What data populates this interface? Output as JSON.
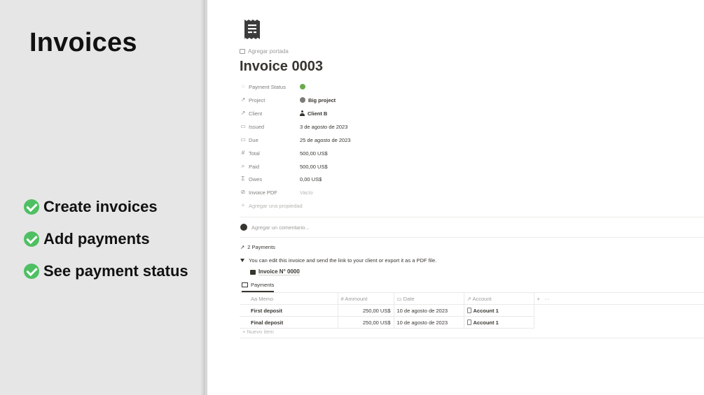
{
  "promo": {
    "title": "Invoices",
    "features": [
      "Create invoices",
      "Add payments",
      "See payment status"
    ]
  },
  "page": {
    "icon": "receipt-icon",
    "add_cover": "Agregar portada",
    "title": "Invoice 0003"
  },
  "properties": [
    {
      "name": "Payment Status",
      "icon": "status-icon",
      "value": ""
    },
    {
      "name": "Project",
      "icon": "relation-arrow-icon",
      "value": "Big project"
    },
    {
      "name": "Client",
      "icon": "relation-arrow-icon",
      "value": "Client B"
    },
    {
      "name": "Issued",
      "icon": "calendar-icon",
      "value": "3 de agosto de 2023"
    },
    {
      "name": "Due",
      "icon": "calendar-icon",
      "value": "25 de agosto de 2023"
    },
    {
      "name": "Total",
      "icon": "number-icon",
      "value": "500,00 US$"
    },
    {
      "name": "Paid",
      "icon": "rollup-search-icon",
      "value": "500,00 US$"
    },
    {
      "name": "Owes",
      "icon": "formula-icon",
      "value": "0,00 US$"
    },
    {
      "name": "Invoice PDF",
      "icon": "paperclip-icon",
      "value": "Vacío"
    }
  ],
  "add_property": "Agregar una propiedad",
  "comment_placeholder": "Agregar un comentario...",
  "payments_count": "2 Payments",
  "toggle_text": "You can edit this invoice and send the link to your client or export it as a PDF file.",
  "linked_page": "Invoice N° 0000",
  "view_tab": "Payments",
  "table": {
    "headers": [
      "Aa Memo",
      "Ammount",
      "Date",
      "Account"
    ],
    "rows": [
      {
        "memo": "First deposit",
        "amount": "250,00 US$",
        "date": "10 de agosto de 2023",
        "account": "Account 1"
      },
      {
        "memo": "Final deposit",
        "amount": "250,00 US$",
        "date": "10 de agosto de 2023",
        "account": "Account 1"
      }
    ],
    "add_col": "+",
    "more": "···",
    "new_item": "+ Nuevo ítem"
  },
  "colors": {
    "status_dot": "#6aaa4b",
    "check": "#4fbf63",
    "left_bg": "#e6e6e6"
  }
}
